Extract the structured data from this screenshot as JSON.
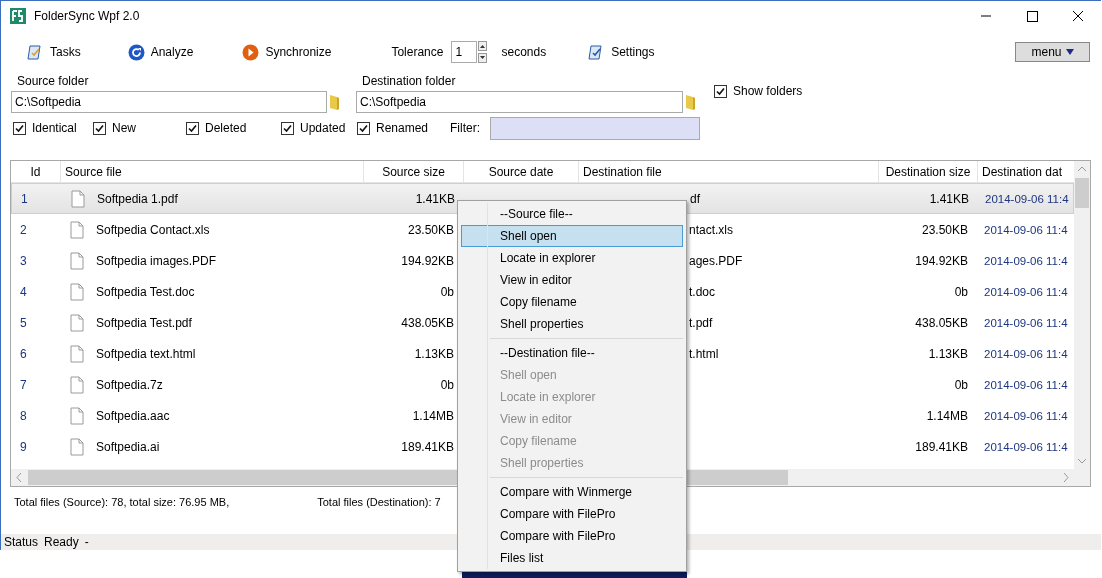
{
  "window": {
    "title": "FolderSync Wpf 2.0"
  },
  "toolbar": {
    "tasks": "Tasks",
    "analyze": "Analyze",
    "synchronize": "Synchronize",
    "tolerance_label": "Tolerance",
    "tolerance_value": "1",
    "tolerance_unit": "seconds",
    "settings": "Settings",
    "menu_button": "menu"
  },
  "source_folder": {
    "label": "Source folder",
    "value": "C:\\Softpedia"
  },
  "destination_folder": {
    "label": "Destination folder",
    "value": "C:\\Softpedia"
  },
  "show_folders": {
    "label": "Show folders",
    "checked": true
  },
  "filters": [
    {
      "label": "Identical",
      "checked": true
    },
    {
      "label": "New",
      "checked": true
    },
    {
      "label": "Deleted",
      "checked": true
    },
    {
      "label": "Updated",
      "checked": true
    },
    {
      "label": "Renamed",
      "checked": true
    }
  ],
  "filter": {
    "label": "Filter:"
  },
  "table": {
    "columns": [
      "Id",
      "Source file",
      "Source size",
      "Source date",
      "Destination file",
      "Destination size",
      "Destination dat"
    ],
    "rows": [
      {
        "id": "1",
        "source_file": "Softpedia 1.pdf",
        "source_size": "1.41KB",
        "destination_file": "df",
        "destination_size": "1.41KB",
        "destination_date": "2014-09-06 11:4",
        "selected": true
      },
      {
        "id": "2",
        "source_file": "Softpedia Contact.xls",
        "source_size": "23.50KB",
        "destination_file": "ntact.xls",
        "destination_size": "23.50KB",
        "destination_date": "2014-09-06 11:4",
        "selected": false
      },
      {
        "id": "3",
        "source_file": "Softpedia images.PDF",
        "source_size": "194.92KB",
        "destination_file": "ages.PDF",
        "destination_size": "194.92KB",
        "destination_date": "2014-09-06 11:4",
        "selected": false
      },
      {
        "id": "4",
        "source_file": "Softpedia Test.doc",
        "source_size": "0b",
        "destination_file": "t.doc",
        "destination_size": "0b",
        "destination_date": "2014-09-06 11:4",
        "selected": false
      },
      {
        "id": "5",
        "source_file": "Softpedia Test.pdf",
        "source_size": "438.05KB",
        "destination_file": "t.pdf",
        "destination_size": "438.05KB",
        "destination_date": "2014-09-06 11:4",
        "selected": false
      },
      {
        "id": "6",
        "source_file": "Softpedia text.html",
        "source_size": "1.13KB",
        "destination_file": "t.html",
        "destination_size": "1.13KB",
        "destination_date": "2014-09-06 11:4",
        "selected": false
      },
      {
        "id": "7",
        "source_file": "Softpedia.7z",
        "source_size": "0b",
        "destination_size": "0b",
        "destination_date": "2014-09-06 11:4",
        "selected": false
      },
      {
        "id": "8",
        "source_file": "Softpedia.aac",
        "source_size": "1.14MB",
        "destination_size": "1.14MB",
        "destination_date": "2014-09-06 11:4",
        "selected": false
      },
      {
        "id": "9",
        "source_file": "Softpedia.ai",
        "source_size": "189.41KB",
        "destination_size": "189.41KB",
        "destination_date": "2014-09-06 11:4",
        "selected": false
      }
    ]
  },
  "context_menu": {
    "items": [
      {
        "kind": "header",
        "label": "--Source file--"
      },
      {
        "kind": "item",
        "label": "Shell open",
        "disabled": false,
        "selected": true
      },
      {
        "kind": "item",
        "label": "Locate in explorer",
        "disabled": false,
        "selected": false
      },
      {
        "kind": "item",
        "label": "View in editor",
        "disabled": false,
        "selected": false
      },
      {
        "kind": "item",
        "label": "Copy filename",
        "disabled": false,
        "selected": false
      },
      {
        "kind": "item",
        "label": "Shell properties",
        "disabled": false,
        "selected": false
      },
      {
        "kind": "separator"
      },
      {
        "kind": "header",
        "label": "--Destination file--"
      },
      {
        "kind": "item",
        "label": "Shell open",
        "disabled": true,
        "selected": false
      },
      {
        "kind": "item",
        "label": "Locate in explorer",
        "disabled": true,
        "selected": false
      },
      {
        "kind": "item",
        "label": "View in editor",
        "disabled": true,
        "selected": false
      },
      {
        "kind": "item",
        "label": "Copy filename",
        "disabled": true,
        "selected": false
      },
      {
        "kind": "item",
        "label": "Shell properties",
        "disabled": true,
        "selected": false
      },
      {
        "kind": "separator"
      },
      {
        "kind": "item",
        "label": "Compare with Winmerge",
        "disabled": false,
        "selected": false
      },
      {
        "kind": "item",
        "label": "Compare with FilePro",
        "disabled": false,
        "selected": false
      },
      {
        "kind": "item",
        "label": "Compare with FilePro",
        "disabled": false,
        "selected": false
      },
      {
        "kind": "item",
        "label": "Files list",
        "disabled": false,
        "selected": false
      }
    ]
  },
  "summary": {
    "source": "Total files (Source): 78, total size: 76.95 MB,",
    "destination": "Total files (Destination): 7"
  },
  "status_bar": {
    "label": "Status",
    "value": "Ready",
    "extra": "-"
  }
}
